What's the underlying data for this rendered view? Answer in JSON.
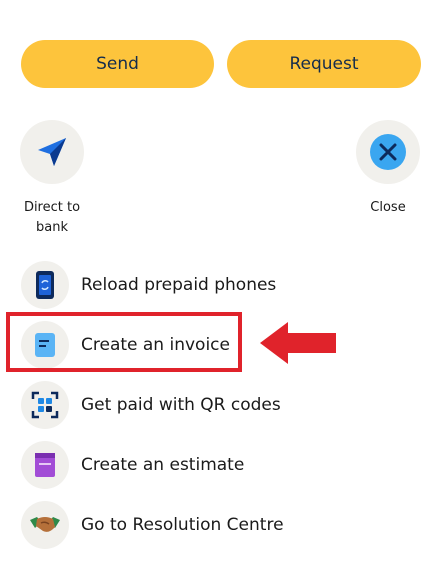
{
  "top_buttons": {
    "send_label": "Send",
    "request_label": "Request"
  },
  "quick_actions": {
    "direct_to_bank": {
      "label_line1": "Direct to",
      "label_line2": "bank",
      "icon": "paper-plane-icon"
    },
    "close": {
      "label": "Close",
      "icon": "close-icon"
    }
  },
  "list": {
    "items": [
      {
        "label": "Reload prepaid phones",
        "icon": "phone-reload-icon"
      },
      {
        "label": "Create an invoice",
        "icon": "invoice-icon"
      },
      {
        "label": "Get paid with QR codes",
        "icon": "qr-code-icon"
      },
      {
        "label": "Create an estimate",
        "icon": "estimate-icon"
      },
      {
        "label": "Go to Resolution Centre",
        "icon": "handshake-icon"
      }
    ]
  },
  "colors": {
    "pill": "#fdc43c",
    "circle_bg": "#f1f0ec",
    "accent_blue": "#1e88e5",
    "annotation_red": "#e0232b"
  }
}
